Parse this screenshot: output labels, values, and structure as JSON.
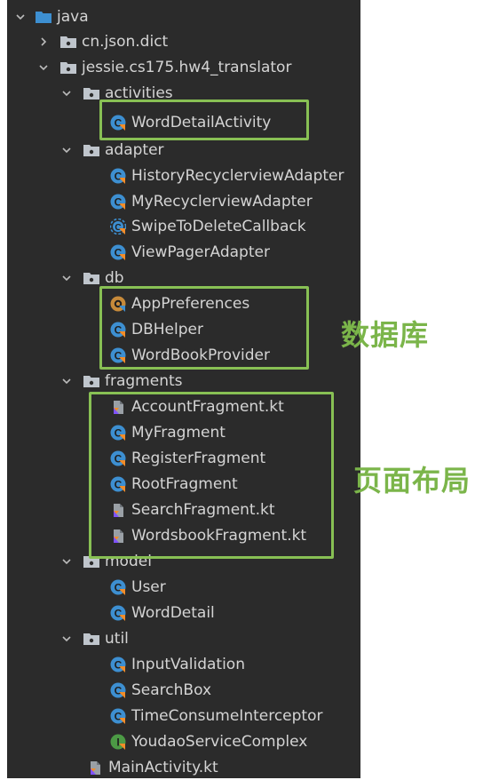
{
  "tree": {
    "root": "java",
    "pkg_json": "cn.json.dict",
    "pkg_main": "jessie.cs175.hw4_translator",
    "activities": "activities",
    "word_detail_activity": "WordDetailActivity",
    "adapter": "adapter",
    "history_adapter": "HistoryRecyclerviewAdapter",
    "my_adapter": "MyRecyclerviewAdapter",
    "swipe_callback": "SwipeToDeleteCallback",
    "viewpager_adapter": "ViewPagerAdapter",
    "db": "db",
    "app_preferences": "AppPreferences",
    "db_helper": "DBHelper",
    "wordbook_provider": "WordBookProvider",
    "fragments": "fragments",
    "account_fragment": "AccountFragment.kt",
    "my_fragment": "MyFragment",
    "register_fragment": "RegisterFragment",
    "root_fragment": "RootFragment",
    "search_fragment": "SearchFragment.kt",
    "wordsbook_fragment": "WordsbookFragment.kt",
    "model": "model",
    "user": "User",
    "word_detail": "WordDetail",
    "util": "util",
    "input_validation": "InputValidation",
    "search_box": "SearchBox",
    "time_interceptor": "TimeConsumeInterceptor",
    "youdao_service": "YoudaoServiceComplex",
    "main_activity": "MainActivity.kt"
  },
  "annotations": {
    "database": "数据库",
    "layout": "页面布局"
  },
  "colors": {
    "panel_bg": "#2b2b2b",
    "text": "#d4d4d4",
    "highlight": "#88c054",
    "folder_blue": "#3d8fd1",
    "package_gray": "#bfc5cc",
    "class_blue": "#3d8fd1",
    "class_orange": "#c78a3a",
    "class_green": "#4c9a45"
  }
}
